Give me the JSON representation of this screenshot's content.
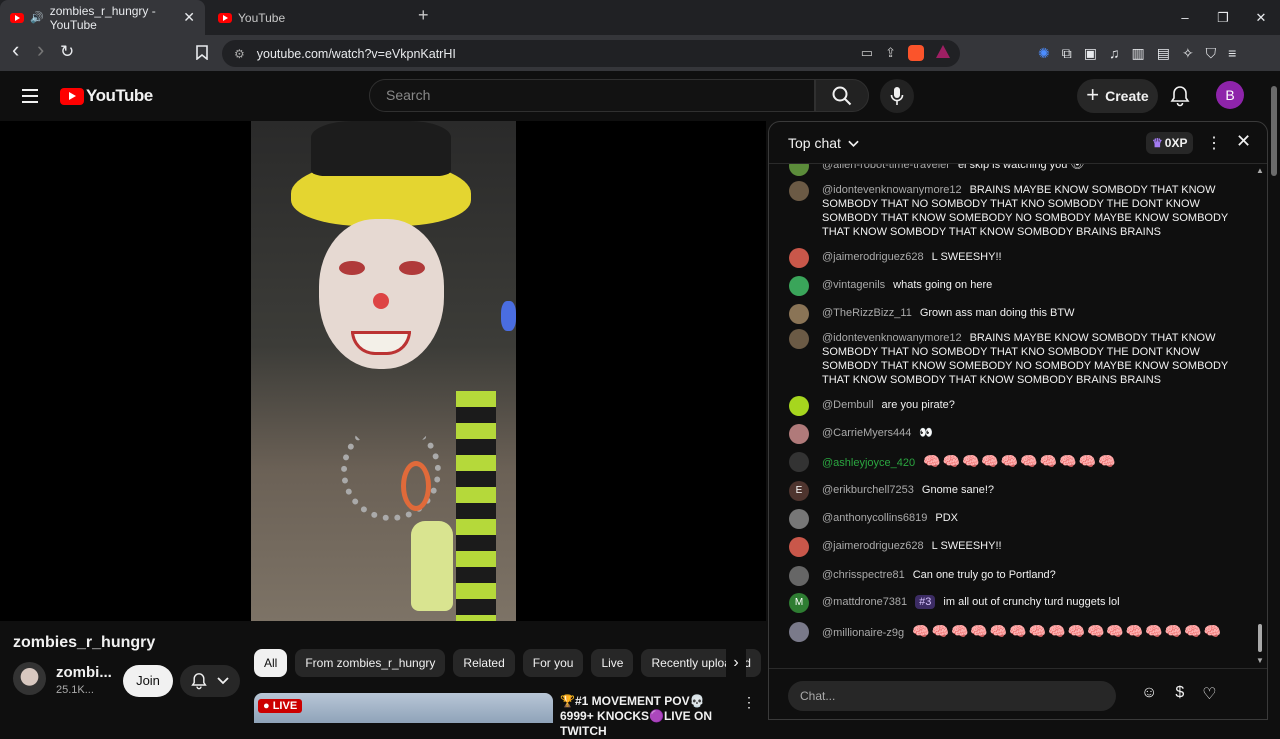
{
  "browser": {
    "tabs": [
      {
        "title": "zombies_r_hungry - YouTube",
        "active": true
      },
      {
        "title": "YouTube",
        "active": false
      }
    ],
    "new_tab": "+",
    "url": "youtube.com/watch?v=eVkpnKatrHI",
    "window_controls": {
      "minimize": "–",
      "maximize": "❐",
      "close": "✕"
    },
    "nav": {
      "back": "‹",
      "forward": "›",
      "reload": "↻",
      "bookmark": "🔖"
    },
    "brave_badge": "99+"
  },
  "youtube": {
    "logo_text": "YouTube",
    "search_placeholder": "Search",
    "create_label": "Create",
    "avatar_letter": "B",
    "brand_color": "#ff0000"
  },
  "video": {
    "channel_title": "zombies_r_hungry",
    "channel_name_short": "zombi...",
    "subscribers": "25.1K...",
    "join_label": "Join"
  },
  "chips": {
    "items": [
      "All",
      "From zombies_r_hungry",
      "Related",
      "For you",
      "Live",
      "Recently uploaded"
    ],
    "selected": "All"
  },
  "recommendation": {
    "live_badge": "LIVE",
    "title": "🏆#1 MOVEMENT POV💀6999+ KNOCKS🟣LIVE ON TWITCH"
  },
  "chat": {
    "header": "Top chat",
    "xp": "0XP",
    "input_placeholder": "Chat...",
    "messages": [
      {
        "author": "@alien-robot-time-traveler",
        "text": "el skip is watching you 👁",
        "avatar_color": "#5b8c3a"
      },
      {
        "author": "@idontevenknowanymore12",
        "text": "BRAINS MAYBE KNOW SOMBODY THAT KNOW SOMBODY THAT NO SOMBODY THAT KNO SOMBODY THE DONT KNOW SOMBODY THAT KNOW SOMEBODY NO SOMBODY MAYBE KNOW SOMBODY THAT KNOW SOMBODY THAT KNOW SOMBODY BRAINS BRAINS",
        "avatar_color": "#6b5a45"
      },
      {
        "author": "@jaimerodriguez628",
        "text": "L SWEESHY!!",
        "avatar_color": "#c9574a"
      },
      {
        "author": "@vintagenils",
        "text": "whats going on here",
        "avatar_color": "#3aa55a"
      },
      {
        "author": "@TheRizzBizz_11",
        "text": "Grown ass man doing this BTW",
        "avatar_color": "#8a7456"
      },
      {
        "author": "@idontevenknowanymore12",
        "text": "BRAINS MAYBE KNOW SOMBODY THAT KNOW SOMBODY THAT NO SOMBODY THAT KNO SOMBODY THE DONT KNOW SOMBODY THAT KNOW SOMEBODY NO SOMBODY MAYBE KNOW SOMBODY THAT KNOW SOMBODY THAT KNOW SOMBODY BRAINS BRAINS",
        "avatar_color": "#6b5a45"
      },
      {
        "author": "@Dembull",
        "text": "are you pirate?",
        "avatar_color": "#a6d61e"
      },
      {
        "author": "@CarrieMyers444",
        "text": "👀",
        "avatar_color": "#b07a7a"
      },
      {
        "author": "@ashleyjoyce_420",
        "text": "🧠🧠🧠🧠🧠🧠🧠🧠🧠🧠",
        "avatar_color": "#333333",
        "moderator": true
      },
      {
        "author": "@erikburchell7253",
        "text": "Gnome sane!?",
        "avatar_color": "#4e342e",
        "initial": "E"
      },
      {
        "author": "@anthonycollins6819",
        "text": "PDX",
        "avatar_color": "#777777"
      },
      {
        "author": "@jaimerodriguez628",
        "text": "L SWEESHY!!",
        "avatar_color": "#c9574a"
      },
      {
        "author": "@chrisspectre81",
        "text": "Can one truly go to Portland?",
        "avatar_color": "#666666"
      },
      {
        "author": "@mattdrone7381",
        "text": "im all out of crunchy turd nuggets lol",
        "avatar_color": "#2e7d32",
        "initial": "M",
        "badge": "#3"
      },
      {
        "author": "@millionaire-z9g",
        "text": "🧠🧠🧠🧠🧠🧠🧠🧠🧠🧠🧠🧠🧠🧠🧠🧠",
        "avatar_color": "#7a7a8a"
      }
    ]
  }
}
